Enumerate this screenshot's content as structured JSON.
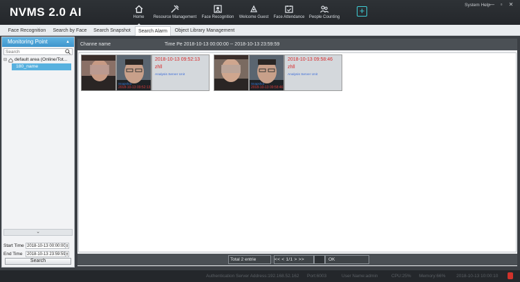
{
  "app": {
    "logo": "NVMS 2.0 AI",
    "system_menu": "System  Help",
    "window_controls": [
      "—",
      "▫",
      "✕"
    ]
  },
  "nav": [
    {
      "label": "Home",
      "icon": "home-icon",
      "active": true
    },
    {
      "label": "Resource Management",
      "icon": "tools-icon",
      "active": false
    },
    {
      "label": "Face Recognition",
      "icon": "face-recognition-icon",
      "active": false
    },
    {
      "label": "Welcome Guest",
      "icon": "welcome-guest-icon",
      "active": false
    },
    {
      "label": "Face Attendance",
      "icon": "calendar-check-icon",
      "active": false
    },
    {
      "label": "People Counting",
      "icon": "people-counting-icon",
      "active": false
    }
  ],
  "add_button": "+",
  "tabs": [
    {
      "label": "Face Recognition",
      "active": false
    },
    {
      "label": "Search by Face",
      "active": false
    },
    {
      "label": "Search Snapshot",
      "active": false
    },
    {
      "label": "Search Alarm",
      "active": true
    },
    {
      "label": "Object Library Management",
      "active": false
    }
  ],
  "sidebar": {
    "title": "Monitoring Point",
    "search_placeholder": "Search",
    "tree": {
      "root_label": "default area (Online/Tot...",
      "child_label": "180_name"
    },
    "start_time_label": "Start Time",
    "start_time_value": "2018-10-13 00:00:00",
    "end_time_label": "End Time",
    "end_time_value": "2018-10-13 23:59:59",
    "search_button": "Search"
  },
  "main": {
    "header_channel": "Channe name",
    "header_time": "Time Pe 2018-10-13 00:00:00 -- 2018-10-13 23:59:59",
    "results": [
      {
        "time": "2018-10-13 09:52:13",
        "name": "zhll",
        "server": "Analysis Server Unit",
        "snapshot_label": "Snapshot",
        "snapshot_time": "2018-10-13 09:52:13"
      },
      {
        "time": "2018-10-13 09:58:46",
        "name": "zhll",
        "server": "Analysis Server Unit",
        "snapshot_label": "Snapshot",
        "snapshot_time": "2018-10-13 09:58:46"
      }
    ],
    "pager": {
      "total": "Total 2 entrie",
      "nav": "<< < 1/1 > >>",
      "ok": "OK"
    }
  },
  "statusbar": {
    "server": "Authentication Server Address:192.168.52.162",
    "port": "Port:6003",
    "user": "User Name:admin",
    "cpu": "CPU:25%",
    "memory": "Memory:66%",
    "datetime": "2018-10-13 10:00:10"
  },
  "colors": {
    "accent": "#58b1df",
    "alarm_text": "#d82a2a",
    "link_text": "#3a6bd8"
  }
}
